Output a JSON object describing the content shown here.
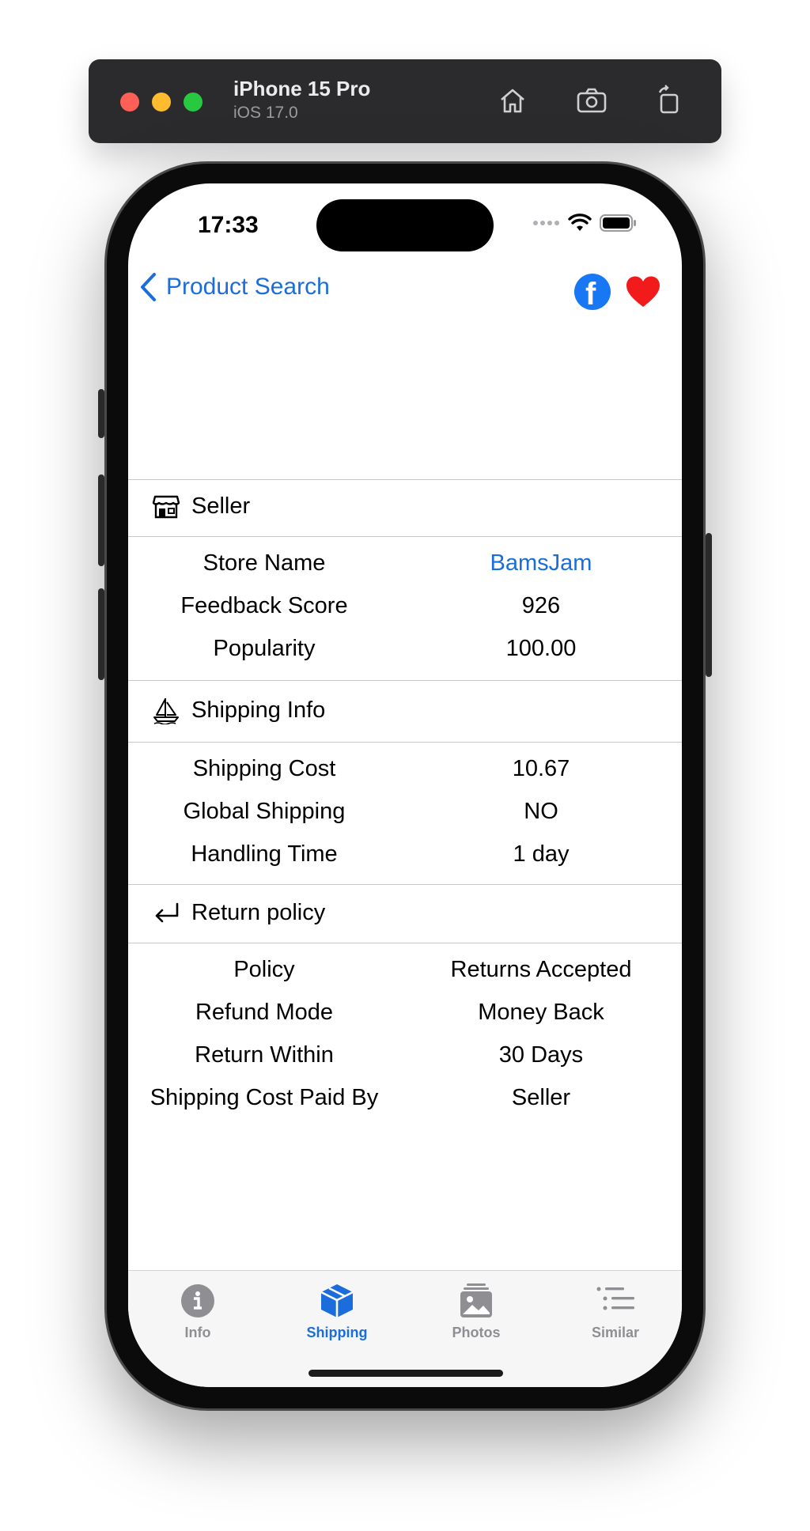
{
  "simulator": {
    "device": "iPhone 15 Pro",
    "os": "iOS 17.0",
    "icons": [
      "home-icon",
      "screenshot-icon",
      "rotate-icon"
    ]
  },
  "status_bar": {
    "time": "17:33"
  },
  "nav": {
    "back_label": "Product Search",
    "actions": [
      "facebook-icon",
      "heart-icon"
    ]
  },
  "seller": {
    "title": "Seller",
    "rows": [
      {
        "key": "Store Name",
        "value": "BamsJam"
      },
      {
        "key": "Feedback Score",
        "value": "926"
      },
      {
        "key": "Popularity",
        "value": "100.00"
      }
    ]
  },
  "shipping": {
    "title": "Shipping Info",
    "rows": [
      {
        "key": "Shipping Cost",
        "value": "10.67"
      },
      {
        "key": "Global Shipping",
        "value": "NO"
      },
      {
        "key": "Handling Time",
        "value": "1 day"
      }
    ]
  },
  "returns": {
    "title": "Return policy",
    "rows": [
      {
        "key": "Policy",
        "value": "Returns Accepted"
      },
      {
        "key": "Refund Mode",
        "value": "Money Back"
      },
      {
        "key": "Return Within",
        "value": "30 Days"
      },
      {
        "key": "Shipping Cost Paid By",
        "value": "Seller"
      }
    ]
  },
  "tabs": [
    {
      "label": "Info",
      "active": false
    },
    {
      "label": "Shipping",
      "active": true
    },
    {
      "label": "Photos",
      "active": false
    },
    {
      "label": "Similar",
      "active": false
    }
  ],
  "colors": {
    "accent": "#1a6ddb",
    "heart": "#f21b1b",
    "facebook": "#1877f2"
  }
}
